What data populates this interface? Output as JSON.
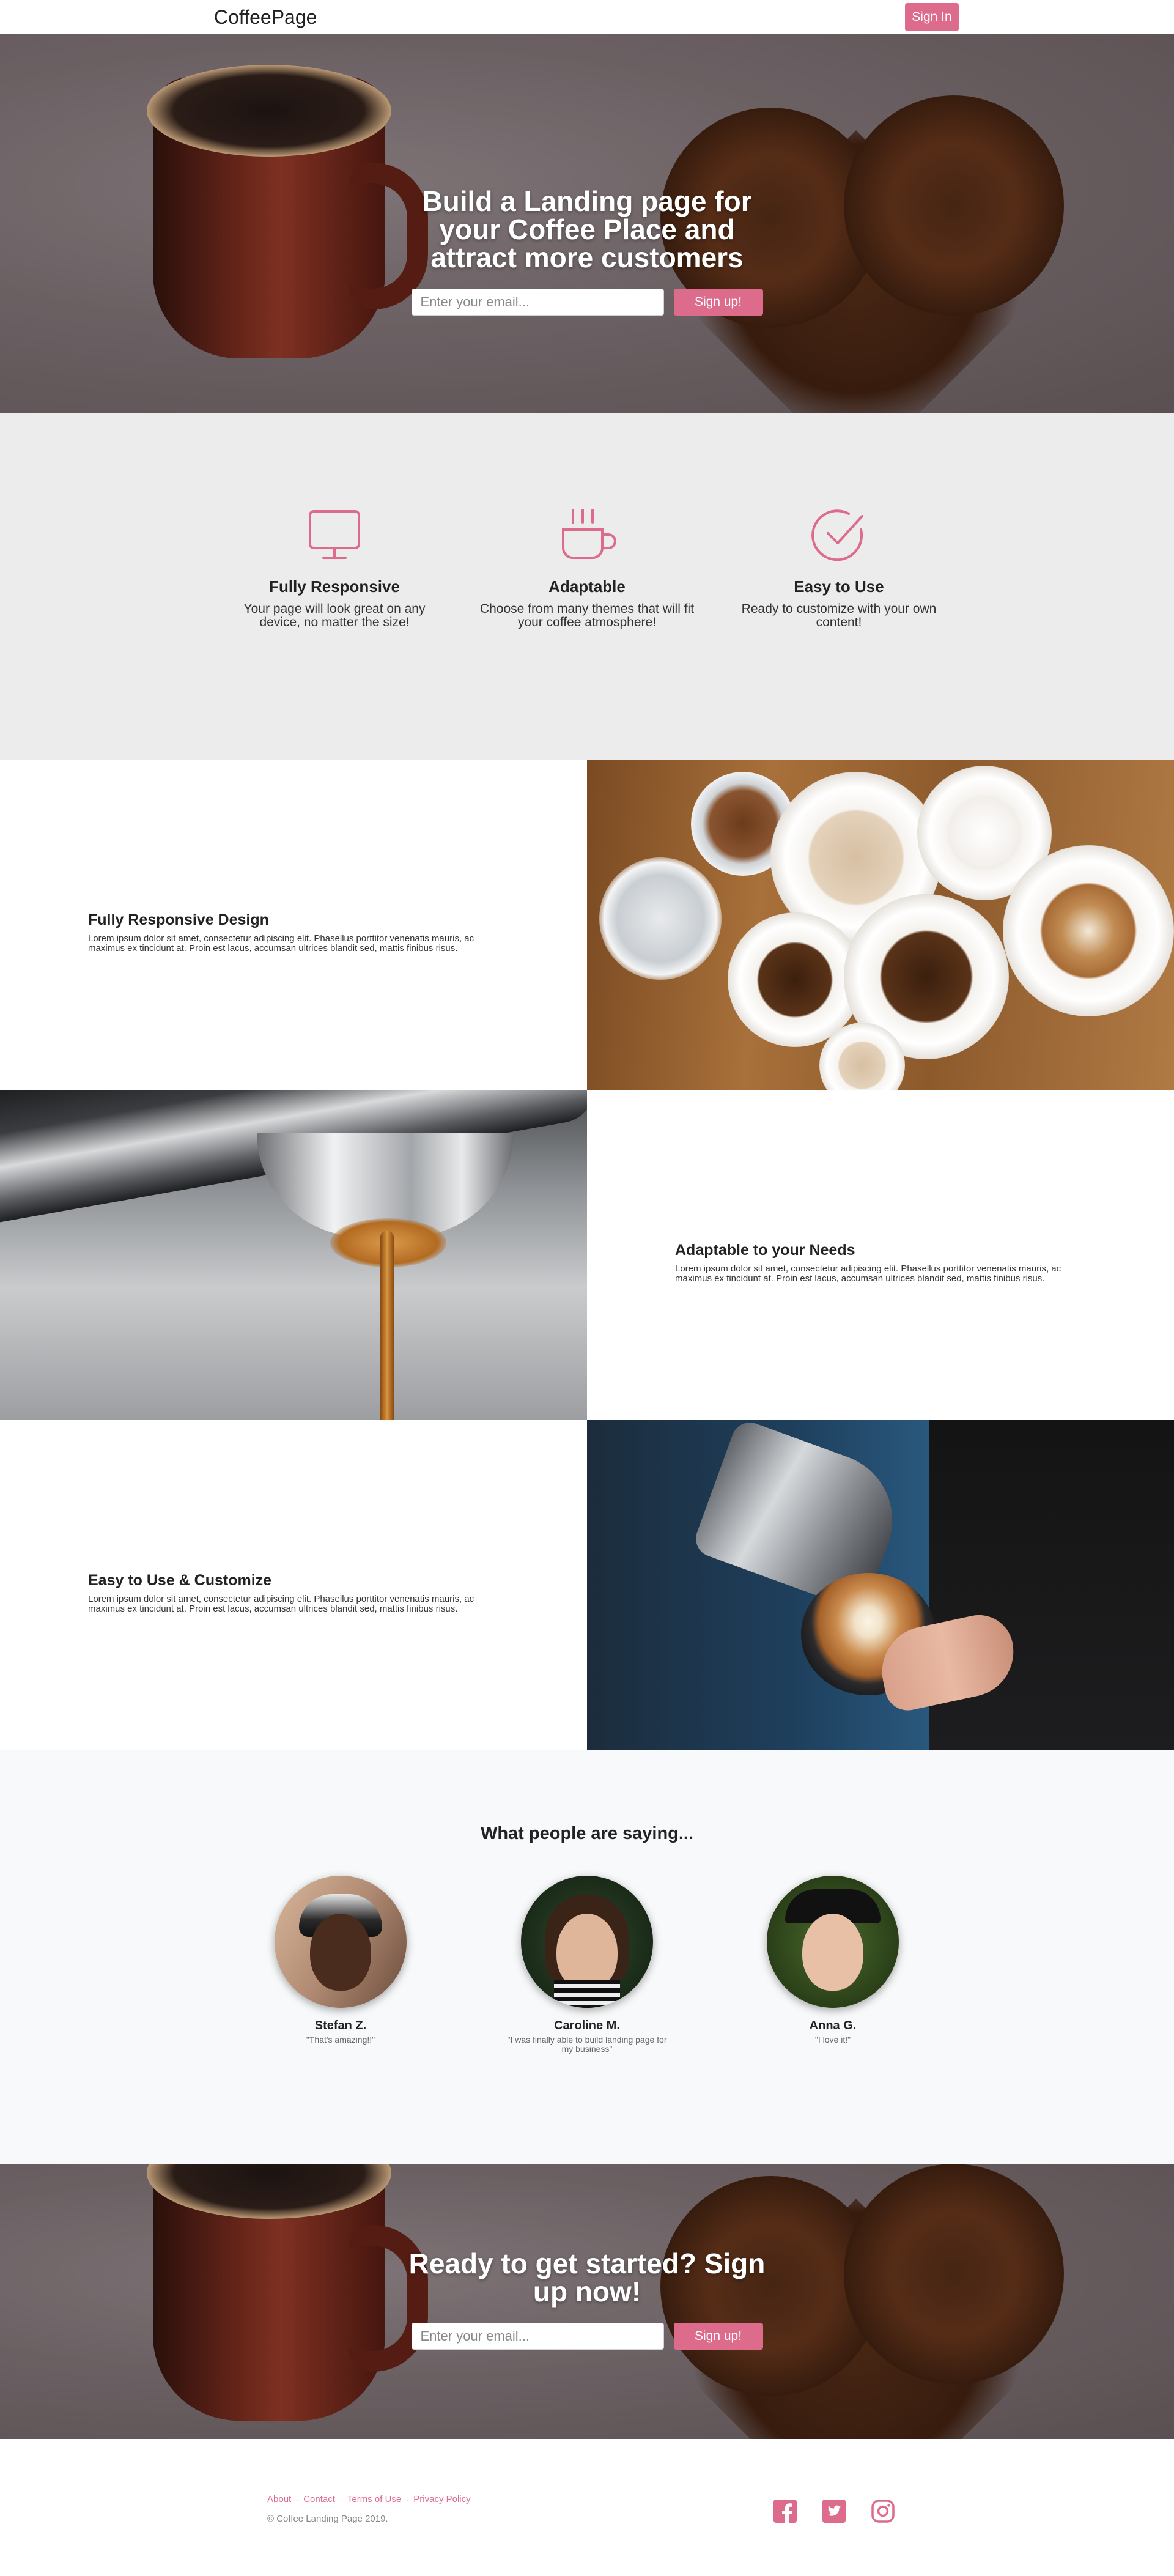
{
  "nav": {
    "brand": "CoffeePage",
    "signin_label": "Sign In"
  },
  "hero": {
    "title": "Build a Landing page for your Coffee Place and attract more customers",
    "email_placeholder": "Enter your email...",
    "signup_label": "Sign up!"
  },
  "features": [
    {
      "icon": "monitor-icon",
      "title": "Fully Responsive",
      "text": "Your page will look great on any device, no matter the size!"
    },
    {
      "icon": "coffee-cup-icon",
      "title": "Adaptable",
      "text": "Choose from many themes that will fit your coffee atmosphere!"
    },
    {
      "icon": "check-circle-icon",
      "title": "Easy to Use",
      "text": "Ready to customize with your own content!"
    }
  ],
  "showcase": [
    {
      "title": "Fully Responsive Design",
      "body": "Lorem ipsum dolor sit amet, consectetur adipiscing elit. Phasellus porttitor venenatis mauris, ac maximus ex tincidunt at. Proin est lacus, accumsan ultrices blandit sed, mattis finibus risus."
    },
    {
      "title": "Adaptable to your Needs",
      "body": "Lorem ipsum dolor sit amet, consectetur adipiscing elit. Phasellus porttitor venenatis mauris, ac maximus ex tincidunt at. Proin est lacus, accumsan ultrices blandit sed, mattis finibus risus."
    },
    {
      "title": "Easy to Use & Customize",
      "body": "Lorem ipsum dolor sit amet, consectetur adipiscing elit. Phasellus porttitor venenatis mauris, ac maximus ex tincidunt at. Proin est lacus, accumsan ultrices blandit sed, mattis finibus risus."
    }
  ],
  "testimonials": {
    "heading": "What people are saying...",
    "people": [
      {
        "name": "Stefan Z.",
        "quote": "\"That's amazing!!\""
      },
      {
        "name": "Caroline M.",
        "quote": "\"I was finally able to build landing page for my business\""
      },
      {
        "name": "Anna G.",
        "quote": "\"I love it!\""
      }
    ]
  },
  "cta": {
    "title": "Ready to get started? Sign up now!",
    "email_placeholder": "Enter your email...",
    "signup_label": "Sign up!"
  },
  "footer": {
    "links": [
      "About",
      "Contact",
      "Terms of Use",
      "Privacy Policy"
    ],
    "separator": "·",
    "copyright": "© Coffee Landing Page 2019.",
    "social": [
      "facebook-icon",
      "twitter-icon",
      "instagram-icon"
    ]
  },
  "colors": {
    "accent": "#dd6b8c",
    "features_bg": "#ececec",
    "testimonials_bg": "#f8f9fa"
  }
}
